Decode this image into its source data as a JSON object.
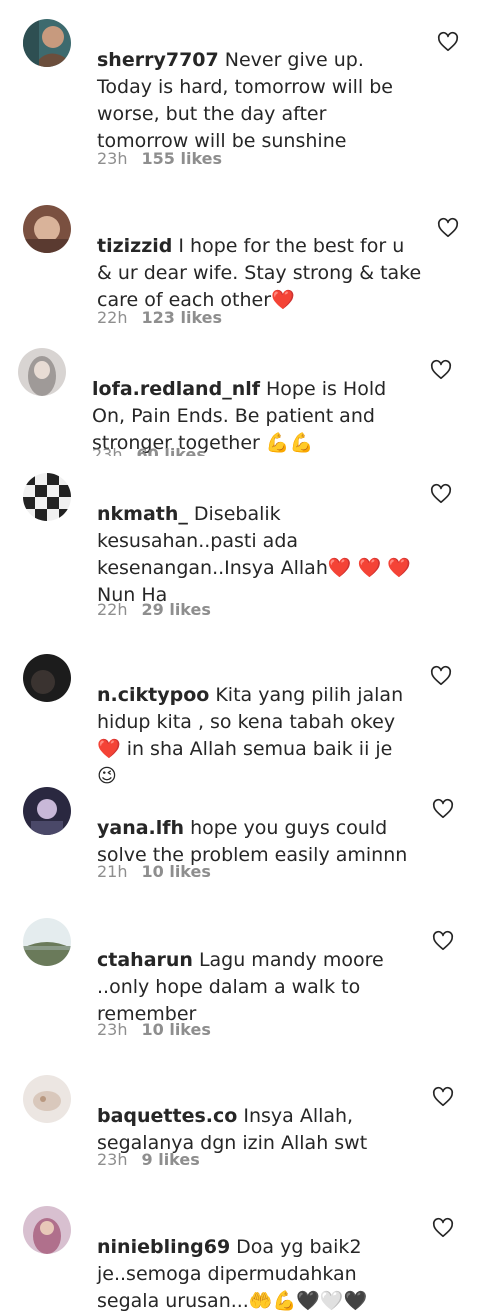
{
  "comments": [
    {
      "username": "sherry7707",
      "text": "Never give up. Today is hard, tomorrow will be worse, but the day after tomorrow will be sunshine",
      "time": "23h",
      "likes": "155 likes",
      "avatar_color": "#6b5a4a"
    },
    {
      "username": "tizizzid",
      "text": "I hope for the best for u & ur dear wife. Stay strong & take care of each other❤️",
      "time": "22h",
      "likes": "123 likes",
      "avatar_color": "#b08a70"
    },
    {
      "username": "lofa.redland_nlf",
      "text": "Hope is Hold On, Pain Ends. Be patient and stronger together 💪💪",
      "time": "23h",
      "likes": "60 likes",
      "avatar_color": "#c9c2bf"
    },
    {
      "username": "nkmath_",
      "text": "Disebalik kesusahan..pasti ada kesenangan..Insya Allah❤️ ❤️ ❤️ Nun Ha",
      "time": "22h",
      "likes": "29 likes",
      "avatar_color": "#3a3a3a"
    },
    {
      "username": "n.ciktypoo",
      "text": "Kita yang pilih jalan hidup kita , so kena tabah okey ❤️ in sha Allah semua baik ii je 😉",
      "time": "",
      "likes": "",
      "avatar_color": "#222222"
    },
    {
      "username": "yana.lfh",
      "text": "hope you guys could solve the problem easily aminnn",
      "time": "21h",
      "likes": "10 likes",
      "avatar_color": "#4a4560"
    },
    {
      "username": "ctaharun",
      "text": "Lagu mandy moore ..only hope dalam a walk to remember",
      "time": "23h",
      "likes": "10 likes",
      "avatar_color": "#7a8a70"
    },
    {
      "username": "baquettes.co",
      "text": "Insya Allah, segalanya dgn izin Allah swt",
      "time": "23h",
      "likes": "9 likes",
      "avatar_color": "#e8e0da"
    },
    {
      "username": "niniebling69",
      "text": "Doa yg baik2 je..semoga dipermudahkan segala urusan...🤲💪🖤🤍🖤",
      "time": "",
      "likes": "",
      "avatar_color": "#a06a80"
    }
  ],
  "like_icon": "heart-outline-icon"
}
